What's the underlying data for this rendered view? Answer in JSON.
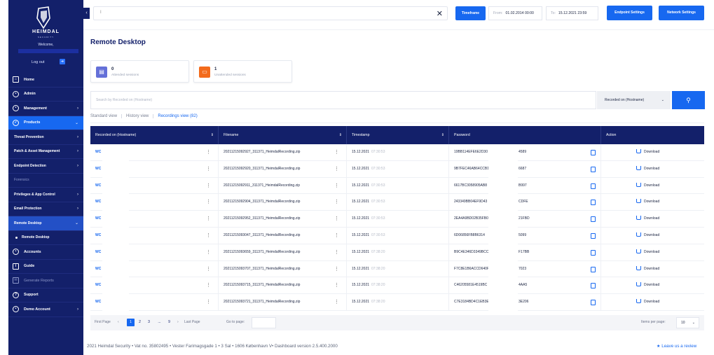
{
  "sidebar": {
    "brand": "HEIMDAL",
    "brand_sub": "SECURITY",
    "welcome": "Welcome,",
    "logout": "Log out",
    "nav": [
      {
        "label": "Home",
        "icon": "home-icon"
      },
      {
        "label": "Admin",
        "icon": "user-icon"
      },
      {
        "label": "Management",
        "icon": "gear-icon",
        "chevron": "›"
      },
      {
        "label": "Products",
        "icon": "shield-icon",
        "chevron": "⌄"
      }
    ],
    "products_sub": [
      {
        "label": "Threat Prevention",
        "chevron": "›"
      },
      {
        "label": "Patch & Asset Management",
        "chevron": "›"
      },
      {
        "label": "Endpoint Detection",
        "chevron": "›"
      },
      {
        "label": "Forensics"
      },
      {
        "label": "Privileges & App Control",
        "chevron": "›"
      },
      {
        "label": "Email Protection",
        "chevron": "›"
      },
      {
        "label": "Remote Desktop",
        "chevron": "⌄"
      }
    ],
    "remote_sub": "Remote Desktop",
    "nav_bottom": [
      {
        "label": "Accounts",
        "icon": "accounts-icon"
      },
      {
        "label": "Guide",
        "icon": "guide-icon"
      },
      {
        "label": "Generate Reports",
        "icon": "mail-icon"
      },
      {
        "label": "Support",
        "icon": "support-icon"
      },
      {
        "label": "Demo Account",
        "icon": "demo-account-icon",
        "chevron": "›"
      }
    ]
  },
  "topbar": {
    "search_value": "I",
    "timeframe": "Timeframe",
    "from_label": "From:",
    "from_value": "01.02.2014 00:00",
    "to_label": "To:",
    "to_value": "15.12.2021 23:59",
    "endpoint_settings": "Endpoint Settings",
    "network_settings": "Network Settings"
  },
  "main": {
    "title": "Remote Desktop",
    "cards": [
      {
        "count": "0",
        "label": "Attended sessions",
        "color": "#6470d8"
      },
      {
        "count": "1",
        "label": "Unattended sessions",
        "color": "#f36b1c"
      }
    ],
    "search_placeholder": "Search by Recorded on (Hostname)",
    "select_value": "Recorded on (Hostname)",
    "views": [
      "Standard view",
      "History view",
      "Recordings view (82)"
    ],
    "columns": [
      "Recorded on (Hostname)",
      "Filename",
      "Timestamp",
      "Password",
      "Action"
    ],
    "rows": [
      {
        "host": "WC",
        "file": "20211215092927_311371_HeimdalRecording.zip",
        "date": "15.12.2021",
        "time": "07:30:53",
        "pw": "19BB114EFE6E2D30",
        "pw2": "4589"
      },
      {
        "host": "WC",
        "file": "20211215092920_311371_HeimdalRecording.zip",
        "date": "15.12.2021",
        "time": "07:30:53",
        "pw": "9B7FEC46AB64CCB1",
        "pw2": "6687"
      },
      {
        "host": "WC",
        "file": "20211215092911_311371_HeimdalRecording.zip",
        "date": "15.12.2021",
        "time": "07:30:53",
        "pw": "6617BC3058905AB8",
        "pw2": "B997"
      },
      {
        "host": "WC",
        "file": "20211215092904_311371_HeimdalRecording.zip",
        "date": "15.12.2021",
        "time": "07:30:53",
        "pw": "243349BB04EF9D43",
        "pw2": "CDFE"
      },
      {
        "host": "WC",
        "file": "20211215092952_311371_HeimdalRecording.zip",
        "date": "15.12.2021",
        "time": "07:30:53",
        "pw": "2EA4A9BD02B35FB0",
        "pw2": "21FBD"
      },
      {
        "host": "WC",
        "file": "20211215093047_311371_HeimdalRecording.zip",
        "date": "15.12.2021",
        "time": "07:30:53",
        "pw": "6D06856FB8B6314",
        "pw2": "5099"
      },
      {
        "host": "WC",
        "file": "20211215093659_311371_HeimdalRecording.zip",
        "date": "15.12.2021",
        "time": "07:38:20",
        "pw": "B9C4E346D3349BCC",
        "pw2": "F17BB"
      },
      {
        "host": "WC",
        "file": "20211215093707_311371_HeimdalRecording.zip",
        "date": "15.12.2021",
        "time": "07:38:20",
        "pw": "F7C8E1B6ACCD640F",
        "pw2": "7023"
      },
      {
        "host": "WC",
        "file": "20211215093715_311371_HeimdalRecording.zip",
        "date": "15.12.2021",
        "time": "07:38:20",
        "pw": "C46205581E4519BC",
        "pw2": "4AA5"
      },
      {
        "host": "WC",
        "file": "20211215093721_311371_HeimdalRecording.zip",
        "date": "15.12.2021",
        "time": "07:38:20",
        "pw": "C7E3184BD4C1EB3E",
        "pw2": "3E206"
      }
    ],
    "download_label": "Download",
    "pager": {
      "first": "First Page",
      "prev": "‹",
      "pages": [
        "1",
        "2",
        "3",
        "...",
        "9"
      ],
      "next": "›",
      "last": "Last Page",
      "goto_label": "Go to page:",
      "ipp_label": "Items per page:",
      "ipp_value": "10"
    }
  },
  "footer": {
    "text": "2021 Heimdal Security • Vat no. 35802495 • Vester Farimagsgade 1 • 3 Sal • 1606 København V• Dashboard version 2.5.400.2000",
    "review": "Leave us a review"
  }
}
